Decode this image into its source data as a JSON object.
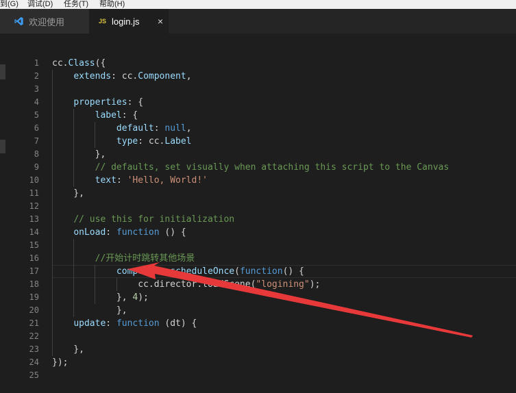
{
  "menubar": {
    "items": [
      "到(G)",
      "调试(D)",
      "任务(T)",
      "帮助(H)"
    ]
  },
  "tabs": [
    {
      "label": "欢迎使用",
      "icon": "vscode-icon"
    },
    {
      "label": "login.js",
      "icon": "js-file-icon",
      "badge": "JS",
      "close": "×"
    }
  ],
  "editor": {
    "line_numbers": [
      "1",
      "2",
      "3",
      "4",
      "5",
      "6",
      "7",
      "8",
      "9",
      "10",
      "11",
      "12",
      "13",
      "14",
      "15",
      "16",
      "17",
      "18",
      "19",
      "20",
      "21",
      "22",
      "23",
      "24",
      "25"
    ],
    "lines": [
      [
        [
          "t",
          "cc."
        ],
        [
          "p",
          "Class"
        ],
        [
          "t",
          "({"
        ]
      ],
      [
        [
          "t",
          "    "
        ],
        [
          "p",
          "extends"
        ],
        [
          "t",
          ": cc."
        ],
        [
          "p",
          "Component"
        ],
        [
          "t",
          ","
        ]
      ],
      [],
      [
        [
          "t",
          "    "
        ],
        [
          "p",
          "properties"
        ],
        [
          "t",
          ": {"
        ]
      ],
      [
        [
          "t",
          "        "
        ],
        [
          "p",
          "label"
        ],
        [
          "t",
          ": {"
        ]
      ],
      [
        [
          "t",
          "            "
        ],
        [
          "p",
          "default"
        ],
        [
          "t",
          ": "
        ],
        [
          "k",
          "null"
        ],
        [
          "t",
          ","
        ]
      ],
      [
        [
          "t",
          "            "
        ],
        [
          "p",
          "type"
        ],
        [
          "t",
          ": cc."
        ],
        [
          "p",
          "Label"
        ]
      ],
      [
        [
          "t",
          "        },"
        ]
      ],
      [
        [
          "t",
          "        "
        ],
        [
          "c",
          "// defaults, set visually when attaching this script to the Canvas"
        ]
      ],
      [
        [
          "t",
          "        "
        ],
        [
          "p",
          "text"
        ],
        [
          "t",
          ": "
        ],
        [
          "s",
          "'Hello, World!'"
        ]
      ],
      [
        [
          "t",
          "    },"
        ]
      ],
      [],
      [
        [
          "t",
          "    "
        ],
        [
          "c",
          "// use this for initialization"
        ]
      ],
      [
        [
          "t",
          "    "
        ],
        [
          "p",
          "onLoad"
        ],
        [
          "t",
          ": "
        ],
        [
          "k",
          "function"
        ],
        [
          "t",
          " () {"
        ]
      ],
      [],
      [
        [
          "t",
          "        "
        ],
        [
          "c",
          "//开始计时跳转其他场景"
        ]
      ],
      [
        [
          "t",
          "            "
        ],
        [
          "p",
          "component"
        ],
        [
          "t",
          "."
        ],
        [
          "p",
          "scheduleOnce"
        ],
        [
          "t",
          "("
        ],
        [
          "k",
          "function"
        ],
        [
          "t",
          "() {"
        ]
      ],
      [
        [
          "t",
          "                cc.director.loadScene("
        ],
        [
          "s",
          "\"logining\""
        ],
        [
          "t",
          ");"
        ]
      ],
      [
        [
          "t",
          "            }, "
        ],
        [
          "n",
          "4"
        ],
        [
          "t",
          ");"
        ]
      ],
      [
        [
          "t",
          "            },"
        ]
      ],
      [
        [
          "t",
          "    "
        ],
        [
          "p",
          "update"
        ],
        [
          "t",
          ": "
        ],
        [
          "k",
          "function"
        ],
        [
          "t",
          " (dt) {"
        ]
      ],
      [],
      [
        [
          "t",
          "    },"
        ]
      ],
      [
        [
          "t",
          "});"
        ]
      ],
      []
    ]
  },
  "colors": {
    "background": "#1e1e1e",
    "arrow": "#e8393a",
    "keyword": "#569cd6",
    "string": "#ce9178",
    "comment": "#6a9955"
  }
}
